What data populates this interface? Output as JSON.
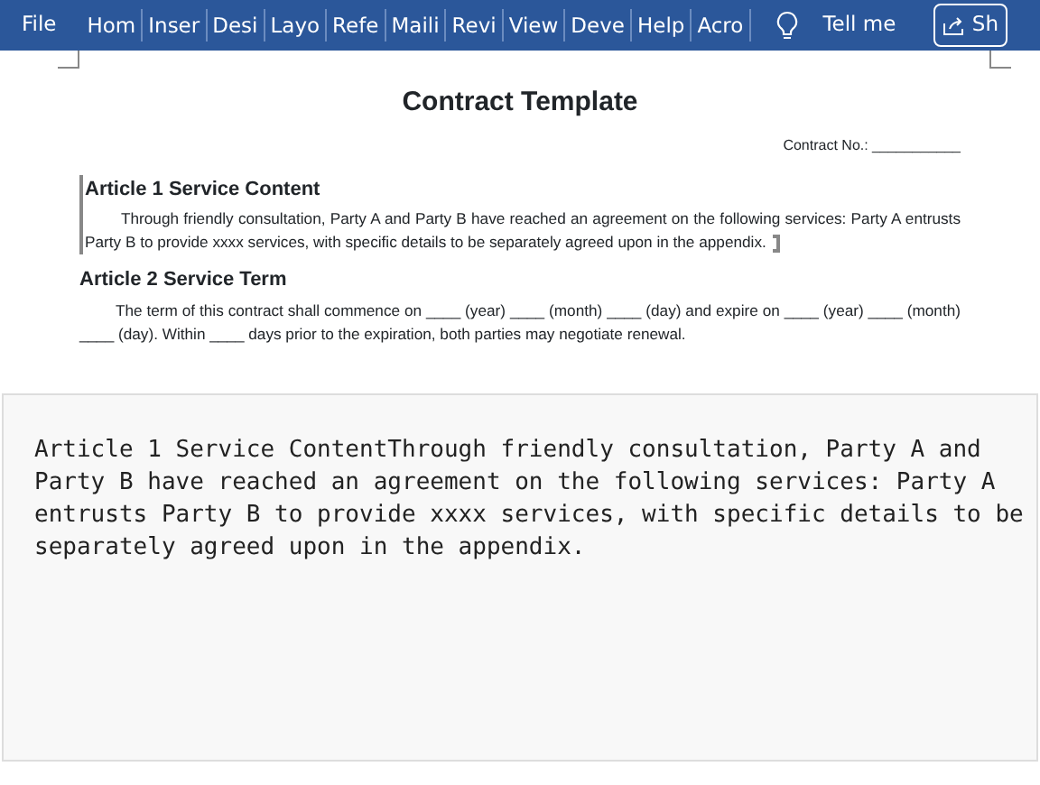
{
  "ribbon": {
    "file_tab": "File",
    "tabs": [
      {
        "label": "Hom",
        "selected": false
      },
      {
        "label": "Inser",
        "selected": false
      },
      {
        "label": "Desi",
        "selected": false
      },
      {
        "label": "Layo",
        "selected": false
      },
      {
        "label": "Refe",
        "selected": false
      },
      {
        "label": "Maili",
        "selected": false
      },
      {
        "label": "Revi",
        "selected": false
      },
      {
        "label": "View",
        "selected": false
      },
      {
        "label": "Deve",
        "selected": false
      },
      {
        "label": "Help",
        "selected": false
      },
      {
        "label": "Acro",
        "selected": false
      }
    ],
    "tell_me": "Tell me",
    "share": "Sh"
  },
  "document": {
    "title": "Contract Template",
    "contract_no": "Contract No.: ___________",
    "sections": [
      {
        "heading": "Article 1 Service Content",
        "body": "Through friendly consultation, Party A and Party B have reached an agreement on the following services: Party A entrusts Party B to provide xxxx services, with specific details to be separately agreed upon in the appendix.",
        "selected": true
      },
      {
        "heading": "Article 2 Service Term",
        "body": "The term of this contract shall commence on ____ (year) ____ (month) ____ (day) and expire on ____ (year) ____ (month) ____ (day). Within ____ days prior to the expiration, both parties may negotiate renewal.",
        "selected": false
      }
    ]
  },
  "preview": {
    "text": "Article 1 Service ContentThrough friendly consultation, Party A and Party B have reached an agreement on the following services: Party A entrusts Party B to provide xxxx services, with specific details to be separately agreed upon in the appendix."
  }
}
